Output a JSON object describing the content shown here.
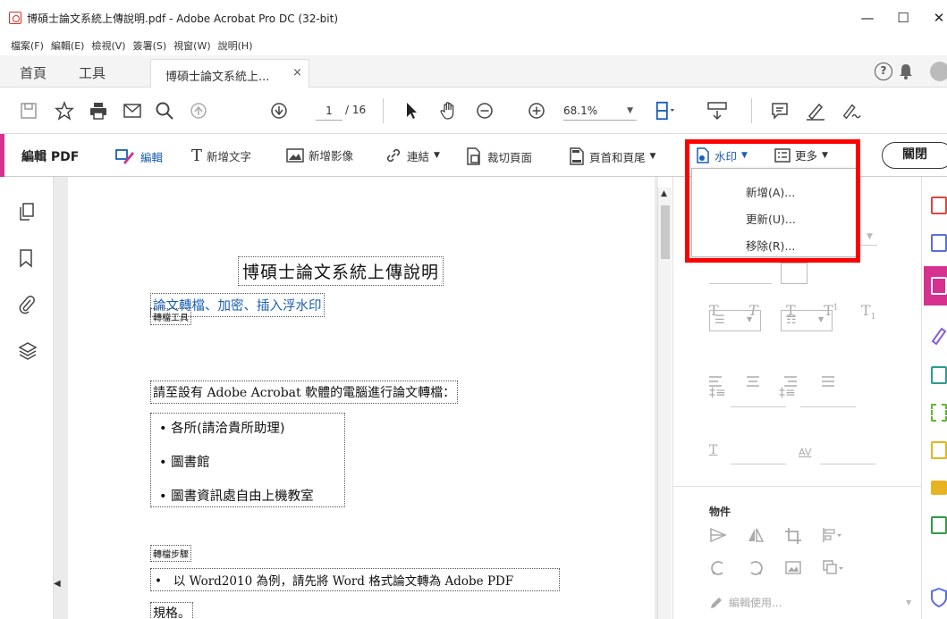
{
  "window": {
    "title": "博碩士論文系統上傳說明.pdf - Adobe Acrobat Pro DC (32-bit)",
    "minimize": "—",
    "maximize": "☐",
    "close": "✕"
  },
  "menu": [
    "檔案(F)",
    "編輯(E)",
    "檢視(V)",
    "簽署(S)",
    "視窗(W)",
    "說明(H)"
  ],
  "tabs": {
    "home": "首頁",
    "tools": "工具",
    "document": "博碩士論文系統上...",
    "close": "×",
    "help": "?"
  },
  "toolbar": {
    "page_current": "1",
    "page_total": "/ 16",
    "zoom": "68.1%"
  },
  "editbar": {
    "title": "編輯 PDF",
    "edit": "編輯",
    "add_text": "新增文字",
    "add_image": "新增影像",
    "link": "連結",
    "crop": "裁切頁面",
    "header_footer": "頁首和頁尾",
    "watermark": "水印",
    "more": "更多",
    "close": "關閉"
  },
  "watermark_menu": {
    "add": "新增(A)...",
    "update": "更新(U)...",
    "remove": "移除(R)..."
  },
  "document": {
    "title": "博碩士論文系統上傳說明",
    "section": "論文轉檔、加密、插入浮水印",
    "tool_heading": "轉檔工具",
    "instruction": "請至設有 Adobe Acrobat 軟體的電腦進行論文轉檔：",
    "bullet1": "各所(請洽貴所助理)",
    "bullet2": "圖書館",
    "bullet3": "圖書資訊處自由上機教室",
    "steps_heading": "轉檔步驟",
    "step1": "以 Word2010 為例，請先將 Word 格式論文轉為 Adobe PDF",
    "step1_cont": "規格。"
  },
  "panel": {
    "objects": "物件",
    "edit_using": "編輯使用..."
  },
  "colors": {
    "accent": "#d6318f",
    "highlight": "#ff0000",
    "link_blue": "#1a5fb4"
  }
}
